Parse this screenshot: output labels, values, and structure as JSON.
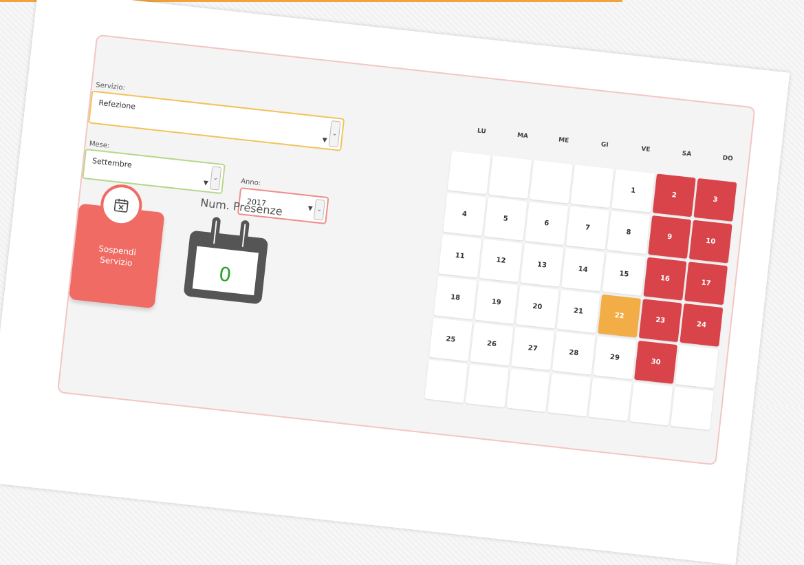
{
  "form": {
    "servizio_label": "Servizio:",
    "servizio_value": "Refezione",
    "mese_label": "Mese:",
    "mese_value": "Settembre",
    "anno_label": "Anno:",
    "anno_value": "2017"
  },
  "suspend": {
    "label_line1": "Sospendi",
    "label_line2": "Servizio"
  },
  "presenze": {
    "title": "Num. Presenze",
    "value": "0"
  },
  "calendar": {
    "weekdays": [
      "LU",
      "MA",
      "ME",
      "GI",
      "VE",
      "SA",
      "DO"
    ],
    "rows": [
      [
        "",
        "",
        "",
        "",
        "1",
        "2",
        "3"
      ],
      [
        "4",
        "5",
        "6",
        "7",
        "8",
        "9",
        "10"
      ],
      [
        "11",
        "12",
        "13",
        "14",
        "15",
        "16",
        "17"
      ],
      [
        "18",
        "19",
        "20",
        "21",
        "22",
        "23",
        "24"
      ],
      [
        "25",
        "26",
        "27",
        "28",
        "29",
        "30",
        ""
      ],
      [
        "",
        "",
        "",
        "",
        "",
        "",
        ""
      ]
    ],
    "highlighted_day": "22",
    "colors": {
      "weekend": "#d9434a",
      "today": "#f2ad47",
      "accent": "#ef6b63"
    }
  }
}
